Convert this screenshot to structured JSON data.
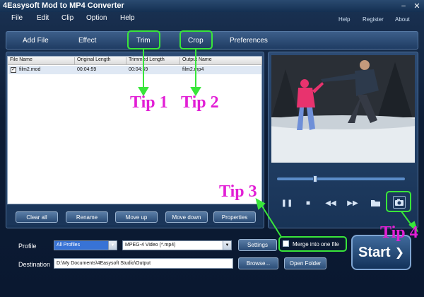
{
  "window": {
    "title": "4Easysoft Mod to MP4 Converter",
    "minimize_icon": "minimize-icon",
    "close_icon": "close-icon"
  },
  "menu": {
    "items": [
      "File",
      "Edit",
      "Clip",
      "Option",
      "Help"
    ],
    "right": [
      "Help",
      "Register",
      "About"
    ]
  },
  "toolbar": {
    "items": [
      "Add File",
      "Effect",
      "Trim",
      "Crop",
      "Preferences"
    ]
  },
  "file_list": {
    "columns": [
      "File Name",
      "Original Length",
      "Trimmed Length",
      "Output Name"
    ],
    "rows": [
      {
        "checked": true,
        "file_name": "film2.mod",
        "original_length": "00:04:59",
        "trimmed_length": "00:04:59",
        "output_name": "film2.mp4"
      }
    ]
  },
  "list_buttons": [
    "Clear all",
    "Rename",
    "Move up",
    "Move down",
    "Properties"
  ],
  "preview": {
    "seek_fraction": 0.3,
    "controls": [
      "pause-icon",
      "stop-icon",
      "rewind-icon",
      "fast-forward-icon",
      "open-folder-icon",
      "snapshot-icon"
    ]
  },
  "output": {
    "profile_label": "Profile",
    "profile_value": "All Profiles",
    "format_value": "MPEG-4 Video (*.mp4)",
    "settings_label": "Settings",
    "merge_label": "Merge into one file",
    "merge_checked": false,
    "destination_label": "Destination",
    "destination_value": "D:\\My Documents\\4Easysoft Studio\\Output",
    "browse_label": "Browse...",
    "open_folder_label": "Open Folder",
    "start_label": "Start"
  },
  "tips": [
    "Tip 1",
    "Tip 2",
    "Tip 3",
    "Tip 4"
  ],
  "colors": {
    "highlight": "#39e63a",
    "tip_text": "#e21fd5",
    "background": "#0d1d36"
  }
}
